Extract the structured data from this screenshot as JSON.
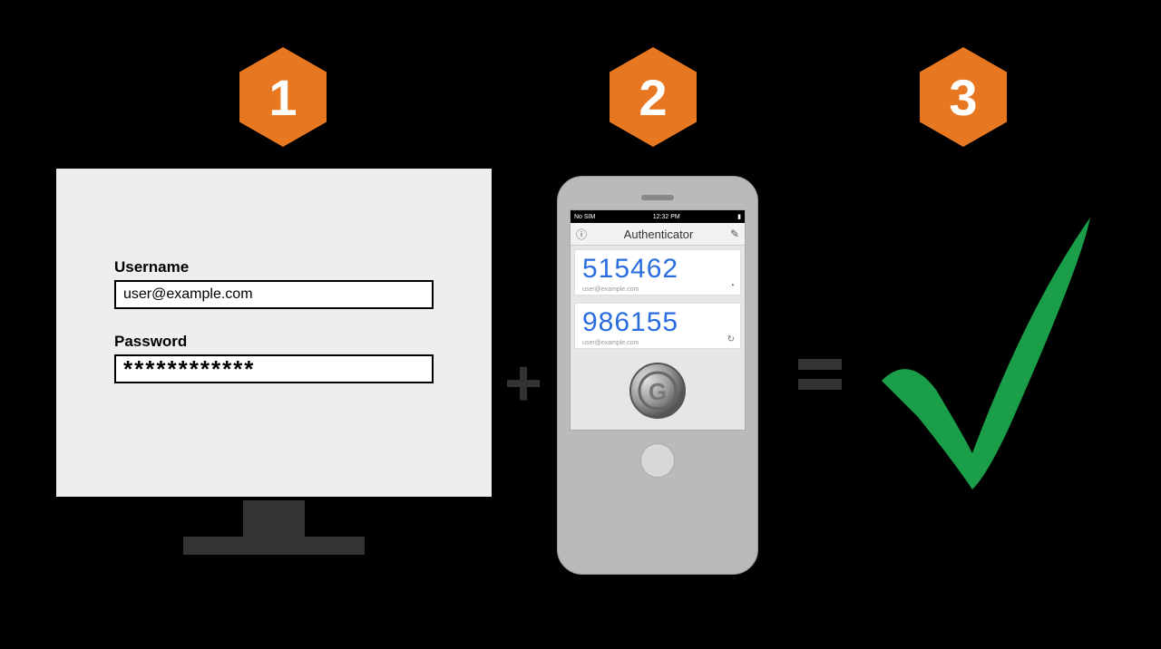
{
  "colors": {
    "accent": "#e87722",
    "success": "#1a9e49",
    "codeBlue": "#2a6de0"
  },
  "steps": {
    "one": "1",
    "two": "2",
    "three": "3"
  },
  "operators": {
    "plus": "+",
    "equals": "="
  },
  "monitor": {
    "usernameLabel": "Username",
    "usernameValue": "user@example.com",
    "passwordLabel": "Password",
    "passwordValue": "************"
  },
  "phone": {
    "status": {
      "left": "No SIM",
      "time": "12:32 PM"
    },
    "nav": {
      "title": "Authenticator",
      "infoIcon": "ⓘ",
      "editIcon": "✎"
    },
    "codes": [
      {
        "code": "515462",
        "account": "user@example.com",
        "icon": "◔"
      },
      {
        "code": "986155",
        "account": "user@example.com",
        "icon": "↻"
      }
    ],
    "logoLetter": "G"
  }
}
